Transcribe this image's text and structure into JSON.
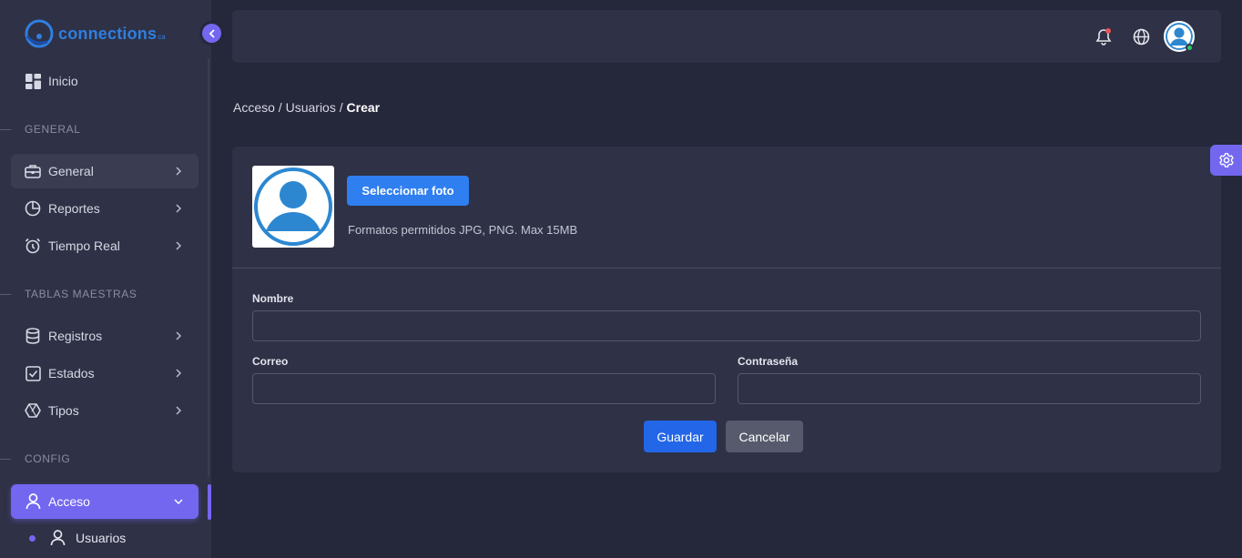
{
  "brand": {
    "name": "connections",
    "suffix": "ca"
  },
  "sidebar": {
    "home": {
      "label": "Inicio",
      "icon": "dashboard-icon"
    },
    "sections": [
      "GENERAL",
      "TABLAS MAESTRAS",
      "CONFIG"
    ],
    "general_items": [
      {
        "label": "General",
        "icon": "briefcase-icon"
      },
      {
        "label": "Reportes",
        "icon": "pie-chart-icon"
      },
      {
        "label": "Tiempo Real",
        "icon": "alarm-clock-icon"
      }
    ],
    "master_items": [
      {
        "label": "Registros",
        "icon": "database-icon"
      },
      {
        "label": "Estados",
        "icon": "checkbox-icon"
      },
      {
        "label": "Tipos",
        "icon": "hexagon-icon"
      }
    ],
    "config_items": [
      {
        "label": "Acceso",
        "icon": "user-icon",
        "active": true
      }
    ],
    "sub_items": [
      {
        "label": "Usuarios",
        "icon": "user-icon"
      }
    ]
  },
  "breadcrumb": {
    "part1": "Acceso",
    "part2": "Usuarios",
    "current": "Crear",
    "separator": " / "
  },
  "card": {
    "select_photo": "Seleccionar foto",
    "formats": "Formatos permitidos JPG, PNG. Max 15MB",
    "fields": {
      "nombre": {
        "label": "Nombre",
        "value": ""
      },
      "correo": {
        "label": "Correo",
        "value": ""
      },
      "contrasena": {
        "label": "Contraseña",
        "value": ""
      }
    },
    "save": "Guardar",
    "cancel": "Cancelar"
  },
  "colors": {
    "accent": "#7367f0",
    "primary": "#2f7ff0",
    "online": "#28c76f",
    "notification": "#ea5455"
  }
}
